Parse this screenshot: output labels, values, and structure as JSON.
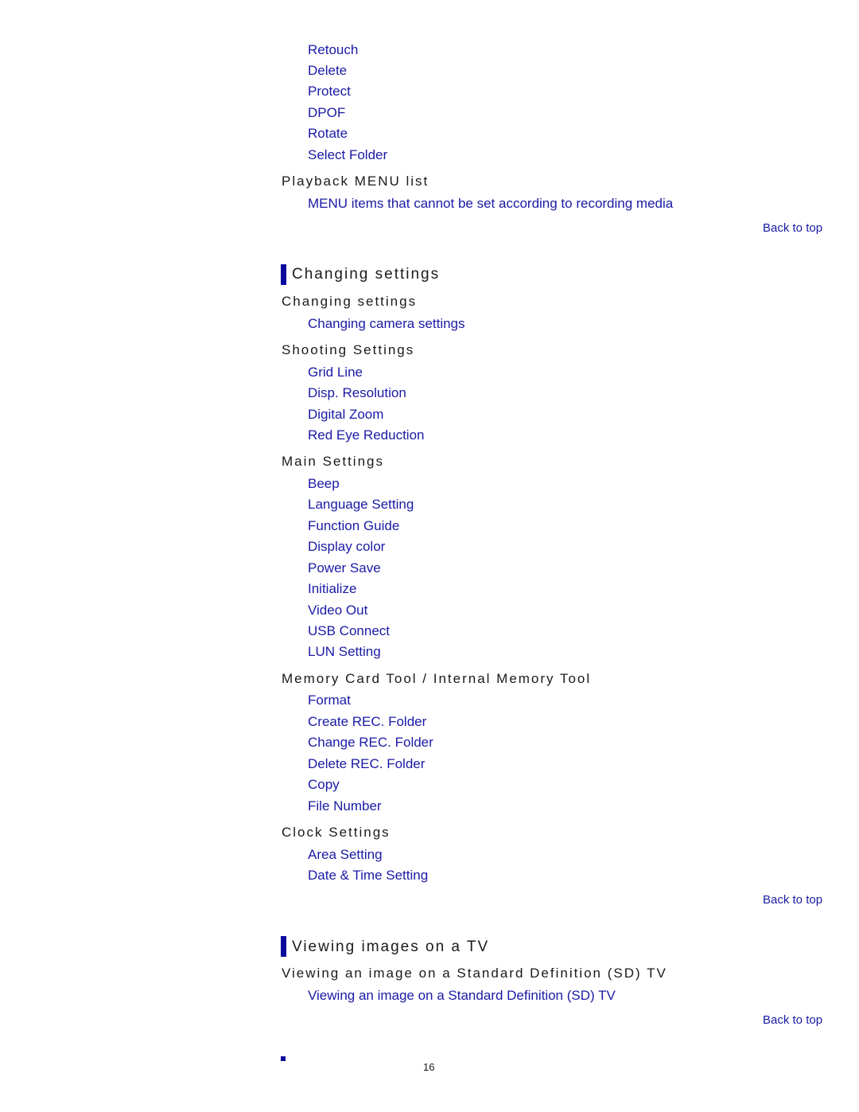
{
  "playback_menu_items": [
    "Retouch",
    "Delete",
    "Protect",
    "DPOF",
    "Rotate",
    "Select Folder"
  ],
  "playback_menu_list": {
    "title": "Playback MENU list",
    "items": [
      "MENU items that cannot be set according to recording media"
    ]
  },
  "back_to_top": "Back to top",
  "changing_settings": {
    "heading": "Changing settings",
    "groups": [
      {
        "title": "Changing settings",
        "items": [
          "Changing camera settings"
        ]
      },
      {
        "title": "Shooting Settings",
        "items": [
          "Grid Line",
          "Disp. Resolution",
          "Digital Zoom",
          "Red Eye Reduction"
        ]
      },
      {
        "title": "Main Settings",
        "items": [
          "Beep",
          "Language Setting",
          "Function Guide",
          "Display color",
          "Power Save",
          "Initialize",
          "Video Out",
          "USB Connect",
          "LUN Setting"
        ]
      },
      {
        "title": "Memory Card Tool / Internal Memory Tool",
        "items": [
          "Format",
          "Create REC. Folder",
          "Change REC. Folder",
          "Delete REC. Folder",
          "Copy",
          "File Number"
        ]
      },
      {
        "title": "Clock Settings",
        "items": [
          "Area Setting",
          "Date & Time Setting"
        ]
      }
    ]
  },
  "viewing_tv": {
    "heading": "Viewing images on a TV",
    "groups": [
      {
        "title": "Viewing an image on a Standard Definition (SD) TV",
        "items": [
          "Viewing an image on a Standard Definition (SD) TV"
        ]
      }
    ]
  },
  "page_number": "16",
  "colors": {
    "link": "#1a1aa6",
    "accent_bar": "#0a0a9c",
    "text": "#1a1a1a"
  }
}
